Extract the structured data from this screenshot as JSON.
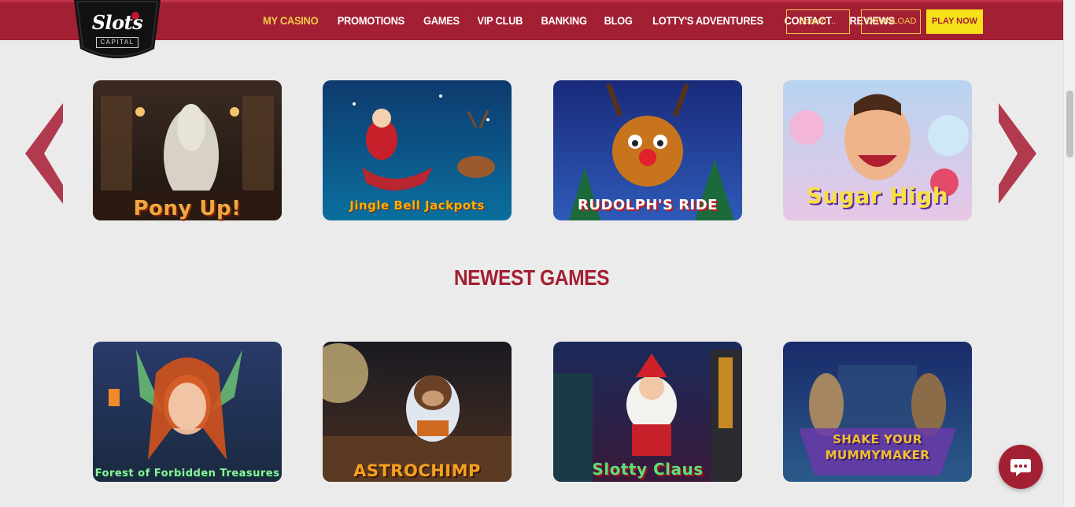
{
  "header": {
    "logo_text": "Slots",
    "logo_sub": "CAPITAL",
    "nav": [
      {
        "label": "MY CASINO",
        "active": true
      },
      {
        "label": "PROMOTIONS"
      },
      {
        "label": "GAMES"
      },
      {
        "label": "VIP CLUB"
      },
      {
        "label": "BANKING"
      },
      {
        "label": "BLOG"
      },
      {
        "label": "LOTTY'S ADVENTURES"
      },
      {
        "label": "CONTACT"
      },
      {
        "label": "REVIEWS"
      }
    ],
    "search_placeholder": "Search ...",
    "download_label": "DOWNLOAD",
    "play_label": "PLAY NOW"
  },
  "featured_games": [
    {
      "title": "Pony Up!"
    },
    {
      "title": "Jingle Bell Jackpots"
    },
    {
      "title": "RUDOLPH'S RIDE"
    },
    {
      "title": "Sugar High"
    }
  ],
  "newest_section": {
    "title": "NEWEST GAMES"
  },
  "newest_games": [
    {
      "title": "Forest of Forbidden Treasures"
    },
    {
      "title": "ASTROCHIMP"
    },
    {
      "title": "Slotty Claus"
    },
    {
      "title": "SHAKE YOUR MUMMYMAKER"
    }
  ],
  "colors": {
    "brand": "#a31f33",
    "accent": "#f2c94c",
    "play_button": "#f7e11a",
    "background": "#ebebeb"
  },
  "icons": {
    "left_arrow": "chevron-left-icon",
    "right_arrow": "chevron-right-icon",
    "chat": "chat-icon"
  }
}
